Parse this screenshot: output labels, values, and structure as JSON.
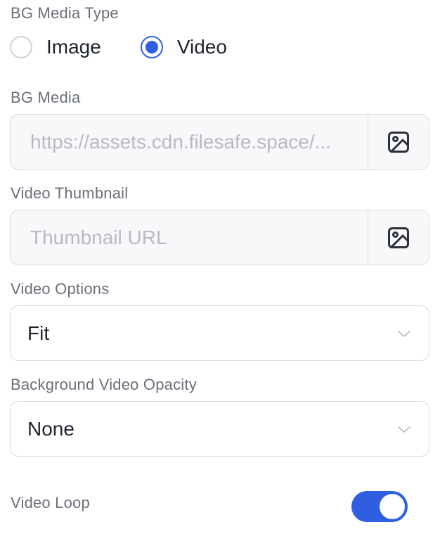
{
  "media_type": {
    "label": "BG Media Type",
    "options": [
      {
        "label": "Image",
        "checked": false
      },
      {
        "label": "Video",
        "checked": true
      }
    ]
  },
  "bg_media": {
    "label": "BG Media",
    "value": "",
    "placeholder": "https://assets.cdn.filesafe.space/...",
    "button_icon": "image-icon"
  },
  "video_thumbnail": {
    "label": "Video Thumbnail",
    "value": "",
    "placeholder": "Thumbnail URL",
    "button_icon": "image-icon"
  },
  "video_options": {
    "label": "Video Options",
    "selected": "Fit"
  },
  "video_opacity": {
    "label": "Background Video Opacity",
    "selected": "None"
  },
  "video_loop": {
    "label": "Video Loop",
    "enabled": true
  },
  "colors": {
    "accent": "#2f5fe0",
    "label": "#6b6f7b",
    "border": "#d9dbe0",
    "placeholder": "#b7bac2"
  }
}
